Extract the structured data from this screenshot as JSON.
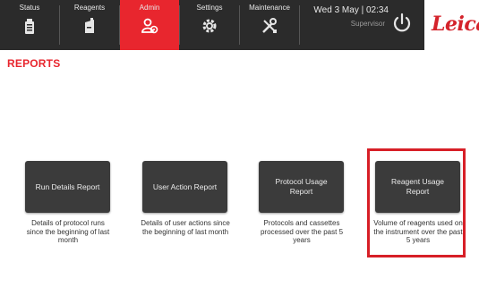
{
  "nav": {
    "tabs": [
      {
        "label": "Status",
        "icon": "status-icon",
        "active": false
      },
      {
        "label": "Reagents",
        "icon": "reagents-icon",
        "active": false
      },
      {
        "label": "Admin",
        "icon": "admin-icon",
        "active": true
      },
      {
        "label": "Settings",
        "icon": "settings-icon",
        "active": false
      },
      {
        "label": "Maintenance",
        "icon": "maintenance-icon",
        "active": false
      }
    ],
    "datetime": "Wed 3 May | 02:34",
    "role": "Supervisor",
    "power_icon": "power-icon",
    "logo": "Leica"
  },
  "page": {
    "title": "REPORTS"
  },
  "reports": [
    {
      "label": "Run Details Report",
      "description": "Details of protocol runs since the beginning of last month"
    },
    {
      "label": "User Action Report",
      "description": "Details of user actions since the beginning of last month"
    },
    {
      "label": "Protocol Usage Report",
      "description": "Protocols and cassettes processed over the past 5 years"
    },
    {
      "label": "Reagent Usage Report",
      "description": "Volume of reagents used on the instrument over the past 5 years"
    }
  ],
  "colors": {
    "accent": "#e8262e",
    "topbar": "#2b2b2b",
    "button": "#3b3b3b",
    "highlight": "#d71f27"
  }
}
